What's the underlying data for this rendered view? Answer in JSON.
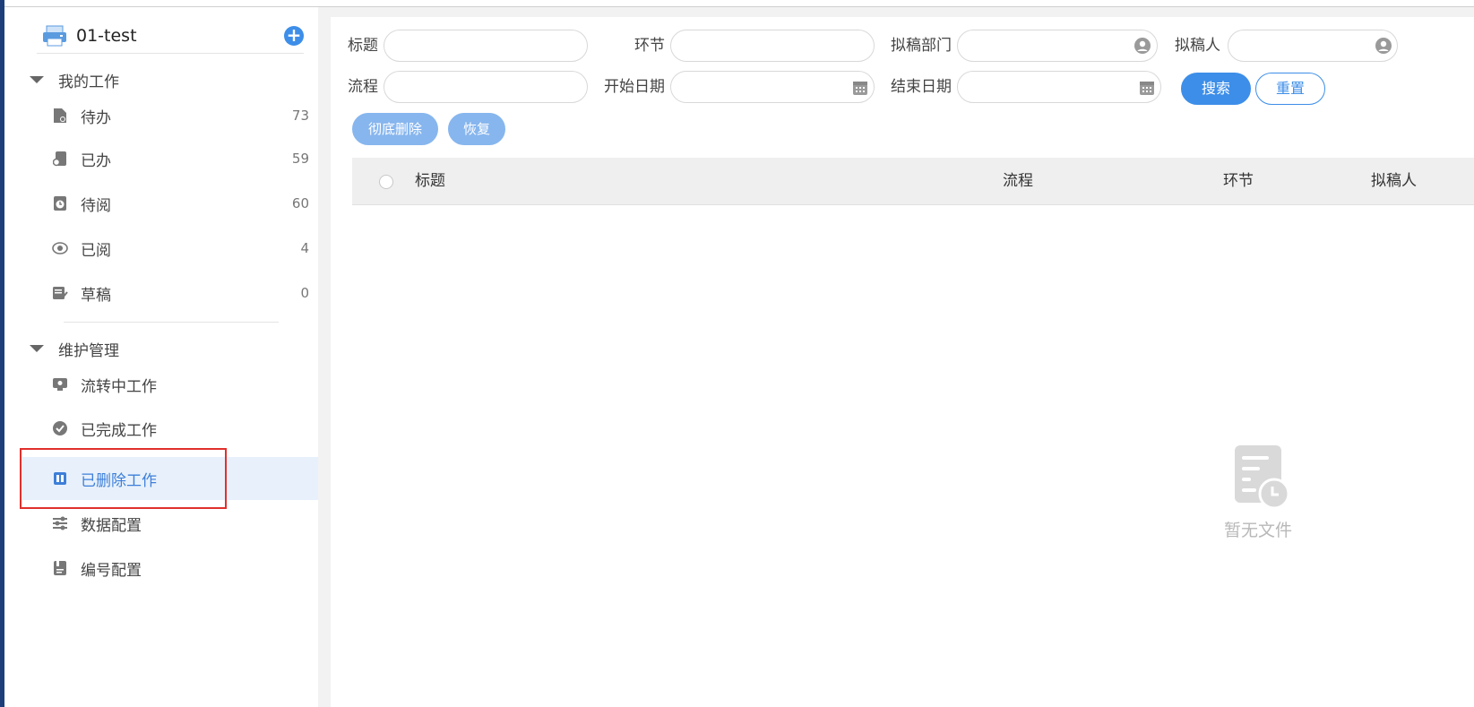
{
  "app": {
    "title": "01-test",
    "add_icon": "plus-circle-icon"
  },
  "sidebar": {
    "groups": [
      {
        "label": "我的工作"
      },
      {
        "label": "维护管理"
      }
    ],
    "my_work": [
      {
        "label": "待办",
        "count": "73",
        "icon": "todo-doc-icon"
      },
      {
        "label": "已办",
        "count": "59",
        "icon": "done-doc-icon"
      },
      {
        "label": "待阅",
        "count": "60",
        "icon": "toread-clock-icon"
      },
      {
        "label": "已阅",
        "count": "4",
        "icon": "read-eye-icon"
      },
      {
        "label": "草稿",
        "count": "0",
        "icon": "draft-edit-icon"
      }
    ],
    "maintenance": [
      {
        "label": "流转中工作",
        "icon": "in-flow-icon"
      },
      {
        "label": "已完成工作",
        "icon": "check-circle-icon"
      },
      {
        "label": "已删除工作",
        "icon": "deleted-icon",
        "active": true
      },
      {
        "label": "数据配置",
        "icon": "sliders-icon"
      },
      {
        "label": "编号配置",
        "icon": "number-config-icon"
      }
    ]
  },
  "filters": {
    "title_label": "标题",
    "node_label": "环节",
    "dept_label": "拟稿部门",
    "drafter_label": "拟稿人",
    "flow_label": "流程",
    "start_label": "开始日期",
    "end_label": "结束日期",
    "title_value": "",
    "node_value": "",
    "dept_value": "",
    "drafter_value": "",
    "flow_value": "",
    "start_value": "",
    "end_value": ""
  },
  "buttons": {
    "search": "搜索",
    "reset": "重置",
    "purge": "彻底删除",
    "restore": "恢复"
  },
  "table": {
    "columns": [
      "标题",
      "流程",
      "环节",
      "拟稿人"
    ],
    "rows": []
  },
  "empty": {
    "text": "暂无文件",
    "icon": "empty-file-icon"
  },
  "colors": {
    "primary": "#3d8ee8",
    "highlight": "#e0302c",
    "active_bg": "#e8f1fb"
  }
}
